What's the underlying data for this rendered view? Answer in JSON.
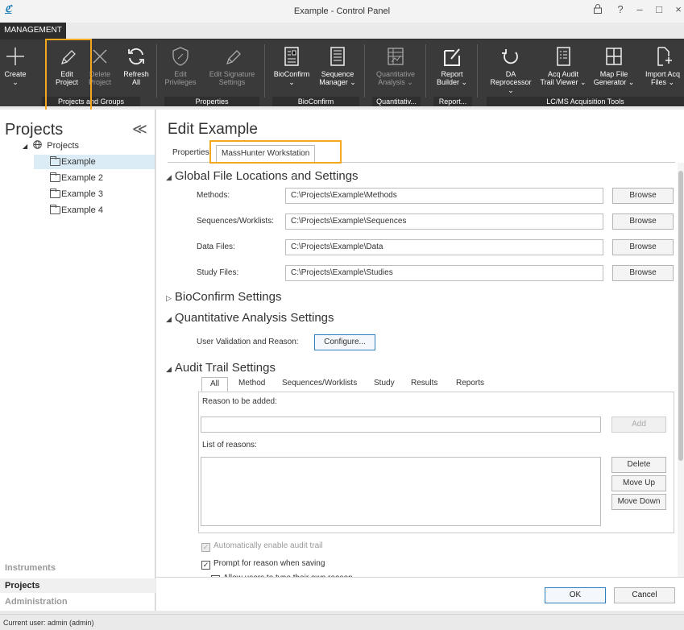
{
  "window": {
    "title": "Example - Control Panel",
    "controls": {
      "lock": "🔒",
      "help": "?",
      "minimize": "–",
      "maximize": "□",
      "close": "×"
    }
  },
  "ribbon": {
    "tab": "MANAGEMENT",
    "buttons": [
      {
        "label": "Create",
        "sub": "⌄",
        "icon": "plus-icon"
      },
      {
        "label": "Edit",
        "sub": "Project",
        "icon": "pencil-icon"
      },
      {
        "label": "Delete",
        "sub": "Project",
        "icon": "x-icon"
      },
      {
        "label": "Refresh",
        "sub": "All",
        "icon": "refresh-icon"
      },
      {
        "label": "Edit",
        "sub": "Privileges",
        "icon": "shield-icon"
      },
      {
        "label": "Edit Signature",
        "sub": "Settings",
        "icon": "pencil-icon"
      },
      {
        "label": "BioConfirm",
        "sub": "⌄",
        "icon": "bioconfirm-icon"
      },
      {
        "label": "Sequence",
        "sub": "Manager ⌄",
        "icon": "sequence-icon"
      },
      {
        "label": "Quantitative",
        "sub": "Analysis ⌄",
        "icon": "quant-icon"
      },
      {
        "label": "Report",
        "sub": "Builder ⌄",
        "icon": "report-icon"
      },
      {
        "label": "DA",
        "sub": "Reprocessor ⌄",
        "icon": "reprocess-icon"
      },
      {
        "label": "Acq Audit",
        "sub": "Trail Viewer ⌄",
        "icon": "audit-icon"
      },
      {
        "label": "Map File",
        "sub": "Generator ⌄",
        "icon": "mapfile-icon"
      },
      {
        "label": "Import Acq",
        "sub": "Files ⌄",
        "icon": "import-icon"
      }
    ],
    "groups": [
      "Projects and Groups",
      "Properties",
      "BioConfirm",
      "Quantitativ...",
      "Report...",
      "LC/MS Acquisition Tools"
    ]
  },
  "left_panel": {
    "title": "Projects",
    "collapse": "≪",
    "tree_root": "Projects",
    "tree_items": [
      "Example",
      "Example 2",
      "Example 3",
      "Example 4"
    ],
    "nav": [
      "Instruments",
      "Projects",
      "Administration"
    ]
  },
  "main": {
    "title": "Edit Example",
    "tabs": [
      "Properties",
      "MassHunter Workstation"
    ],
    "global_section": "Global File Locations and Settings",
    "locations": [
      {
        "label": "Methods:",
        "value": "C:\\Projects\\Example\\Methods",
        "button": "Browse"
      },
      {
        "label": "Sequences/Worklists:",
        "value": "C:\\Projects\\Example\\Sequences",
        "button": "Browse"
      },
      {
        "label": "Data Files:",
        "value": "C:\\Projects\\Example\\Data",
        "button": "Browse"
      },
      {
        "label": "Study Files:",
        "value": "C:\\Projects\\Example\\Studies",
        "button": "Browse"
      }
    ],
    "bioconfirm_section": "BioConfirm Settings",
    "quant_section": "Quantitative Analysis Settings",
    "user_validation_label": "User Validation and Reason:",
    "configure_button": "Configure...",
    "audit_section": "Audit Trail Settings",
    "audit_tabs": [
      "All",
      "Method",
      "Sequences/Worklists",
      "Study",
      "Results",
      "Reports"
    ],
    "reason_label": "Reason to be added:",
    "reason_value": "",
    "add_button": "Add",
    "list_label": "List of reasons:",
    "delete_button": "Delete",
    "move_up_button": "Move Up",
    "move_down_button": "Move Down",
    "auto_enable": "Automatically enable audit trail",
    "prompt_reason": "Prompt for reason when saving",
    "allow_type": "Allow users to type their own reason",
    "ok_button": "OK",
    "cancel_button": "Cancel"
  },
  "status": "Current user: admin (admin)",
  "colors": {
    "ribbon": "#3a3a3a",
    "highlight": "#f2a81d",
    "selection": "#dcecf7",
    "accent": "#2f7fbf"
  }
}
